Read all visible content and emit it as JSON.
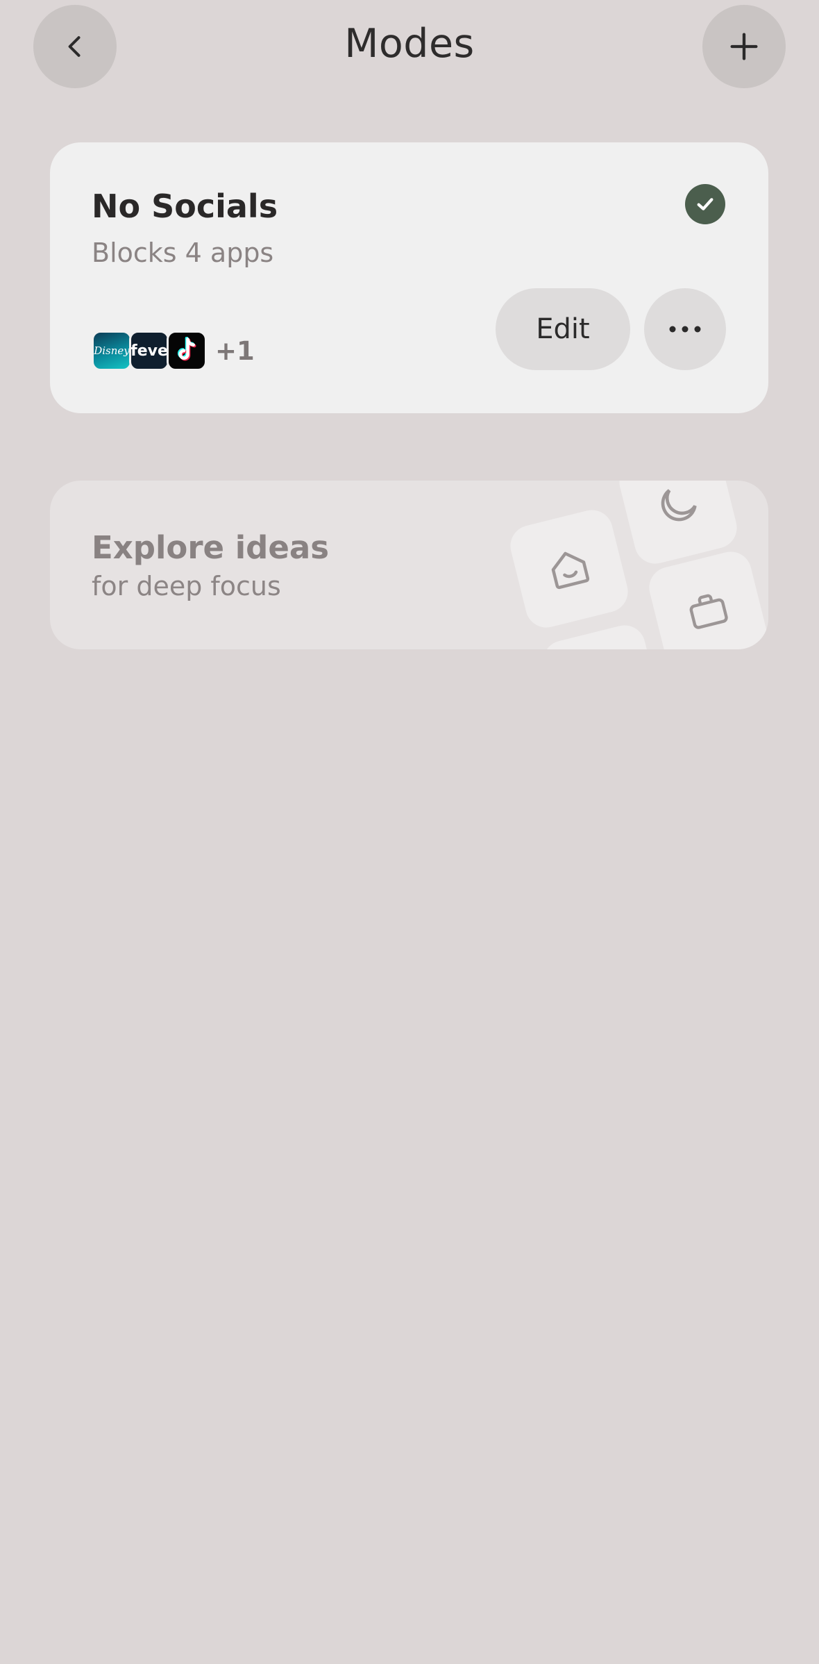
{
  "header": {
    "title": "Modes",
    "back_icon": "chevron-left-icon",
    "add_icon": "plus-icon"
  },
  "mode_card": {
    "name": "No Socials",
    "subtitle": "Blocks 4 apps",
    "active_icon": "check-circle-icon",
    "active_color": "#4b5e4d",
    "apps": [
      {
        "name": "Disney+",
        "icon_text": "Disney"
      },
      {
        "name": "Fever",
        "icon_text": "feve"
      },
      {
        "name": "TikTok",
        "icon_text": ""
      }
    ],
    "more_count": "+1",
    "edit_label": "Edit",
    "more_icon": "more-horizontal-icon"
  },
  "explore_card": {
    "title": "Explore ideas",
    "subtitle": "for deep focus",
    "decor_icons": [
      "moon-icon",
      "home-icon",
      "briefcase-icon"
    ]
  },
  "colors": {
    "background": "#dcd6d6",
    "card": "#f0f0f0",
    "button": "#dedcdc"
  }
}
